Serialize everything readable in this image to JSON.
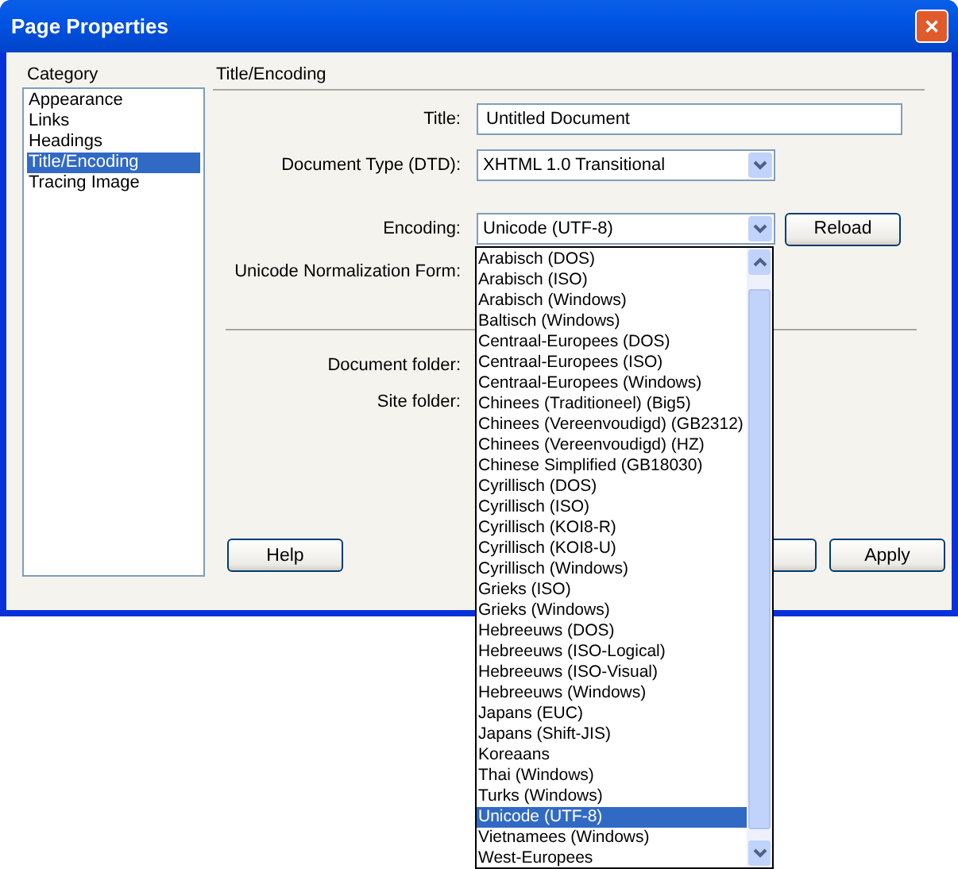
{
  "window": {
    "title": "Page Properties",
    "close": "✕"
  },
  "category": {
    "label": "Category",
    "items": [
      {
        "label": "Appearance",
        "selected": false
      },
      {
        "label": "Links",
        "selected": false
      },
      {
        "label": "Headings",
        "selected": false
      },
      {
        "label": "Title/Encoding",
        "selected": true
      },
      {
        "label": "Tracing Image",
        "selected": false
      }
    ]
  },
  "panel": {
    "heading": "Title/Encoding",
    "title_field": {
      "label": "Title:",
      "value": "Untitled Document"
    },
    "document_type": {
      "label": "Document Type (DTD):",
      "value": "XHTML 1.0 Transitional"
    },
    "encoding": {
      "label": "Encoding:",
      "value": "Unicode (UTF-8)",
      "reload": "Reload"
    },
    "normalization": {
      "label": "Unicode Normalization Form:"
    },
    "document_folder": {
      "label": "Document folder:"
    },
    "site_folder": {
      "label": "Site folder:"
    }
  },
  "buttons": [
    "Help",
    "Apply"
  ],
  "encoding_list": [
    {
      "label": "Arabisch (DOS)",
      "selected": false
    },
    {
      "label": "Arabisch (ISO)",
      "selected": false
    },
    {
      "label": "Arabisch (Windows)",
      "selected": false
    },
    {
      "label": "Baltisch (Windows)",
      "selected": false
    },
    {
      "label": "Centraal-Europees (DOS)",
      "selected": false
    },
    {
      "label": "Centraal-Europees (ISO)",
      "selected": false
    },
    {
      "label": "Centraal-Europees (Windows)",
      "selected": false
    },
    {
      "label": "Chinees (Traditioneel) (Big5)",
      "selected": false
    },
    {
      "label": "Chinees (Vereenvoudigd) (GB2312)",
      "selected": false
    },
    {
      "label": "Chinees (Vereenvoudigd) (HZ)",
      "selected": false
    },
    {
      "label": "Chinese Simplified (GB18030)",
      "selected": false
    },
    {
      "label": "Cyrillisch (DOS)",
      "selected": false
    },
    {
      "label": "Cyrillisch (ISO)",
      "selected": false
    },
    {
      "label": "Cyrillisch (KOI8-R)",
      "selected": false
    },
    {
      "label": "Cyrillisch (KOI8-U)",
      "selected": false
    },
    {
      "label": "Cyrillisch (Windows)",
      "selected": false
    },
    {
      "label": "Grieks (ISO)",
      "selected": false
    },
    {
      "label": "Grieks (Windows)",
      "selected": false
    },
    {
      "label": "Hebreeuws (DOS)",
      "selected": false
    },
    {
      "label": "Hebreeuws (ISO-Logical)",
      "selected": false
    },
    {
      "label": "Hebreeuws (ISO-Visual)",
      "selected": false
    },
    {
      "label": "Hebreeuws (Windows)",
      "selected": false
    },
    {
      "label": "Japans (EUC)",
      "selected": false
    },
    {
      "label": "Japans (Shift-JIS)",
      "selected": false
    },
    {
      "label": "Koreaans",
      "selected": false
    },
    {
      "label": "Thai (Windows)",
      "selected": false
    },
    {
      "label": "Turks (Windows)",
      "selected": false
    },
    {
      "label": "Unicode (UTF-8)",
      "selected": true
    },
    {
      "label": "Vietnamees (Windows)",
      "selected": false
    },
    {
      "label": "West-Europees",
      "selected": false
    }
  ]
}
